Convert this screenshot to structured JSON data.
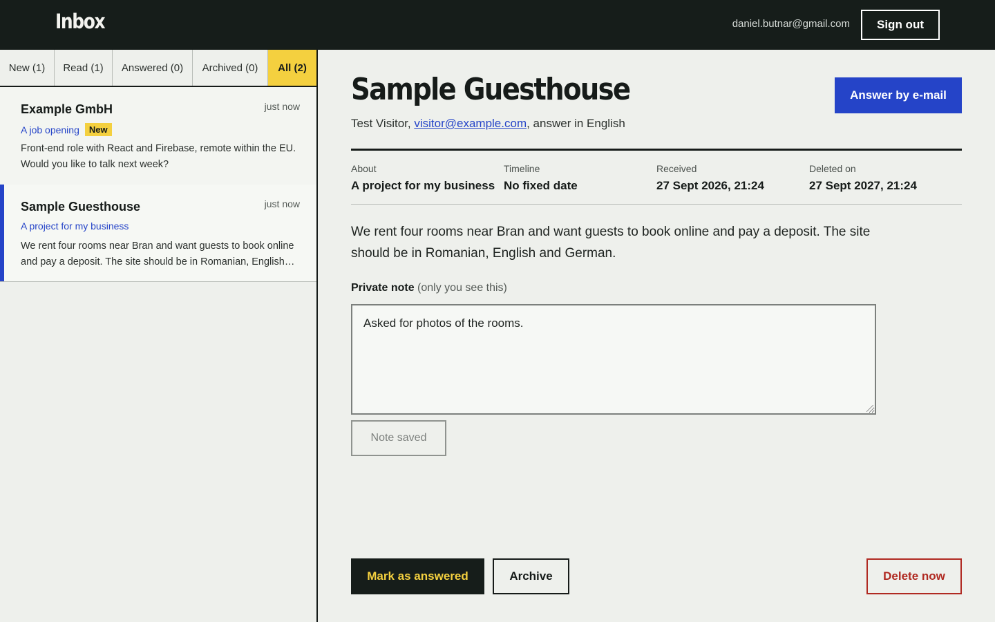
{
  "header": {
    "brand": "Inbox",
    "user_email": "daniel.butnar@gmail.com",
    "sign_out_label": "Sign out"
  },
  "tabs": [
    {
      "label": "New (1)",
      "active": false
    },
    {
      "label": "Read (1)",
      "active": false
    },
    {
      "label": "Answered (0)",
      "active": false
    },
    {
      "label": "Archived (0)",
      "active": false
    },
    {
      "label": "All (2)",
      "active": true
    }
  ],
  "messages": [
    {
      "name": "Example GmbH",
      "time": "just now",
      "topic": "A job opening",
      "badge": "New",
      "preview": "Front-end role with React and Firebase, remote within the EU. Would you like to talk next week?",
      "selected": false
    },
    {
      "name": "Sample Guesthouse",
      "time": "just now",
      "topic": "A project for my business",
      "preview": "We rent four rooms near Bran and want guests to book online and pay a deposit. The site should be in Romanian, English and German.",
      "selected": true
    }
  ],
  "detail": {
    "title": "Sample Guesthouse",
    "answer_button": "Answer by e-mail",
    "sender_name": "Test Visitor,",
    "sender_email": "visitor@example.com",
    "sender_suffix": ", answer in English",
    "meta": [
      {
        "label": "About",
        "value": "A project for my business"
      },
      {
        "label": "Timeline",
        "value": "No fixed date"
      },
      {
        "label": "Received",
        "value": "27 Sept 2026, 21:24"
      },
      {
        "label": "Deleted on",
        "value": "27 Sept 2027, 21:24"
      }
    ],
    "message": "We rent four rooms near Bran and want guests to book online and pay a deposit. The site should be in Romanian, English and German.",
    "note_label": "Private note",
    "note_hint": "(only you see this)",
    "note_value": "Asked for photos of the rooms.",
    "note_saved_label": "Note saved",
    "mark_answered_label": "Mark as answered",
    "archive_label": "Archive",
    "delete_label": "Delete now"
  },
  "colors": {
    "header_bg": "#161d1a",
    "accent_yellow": "#f4d03f",
    "accent_blue": "#2544c8",
    "danger_red": "#b02a22"
  }
}
